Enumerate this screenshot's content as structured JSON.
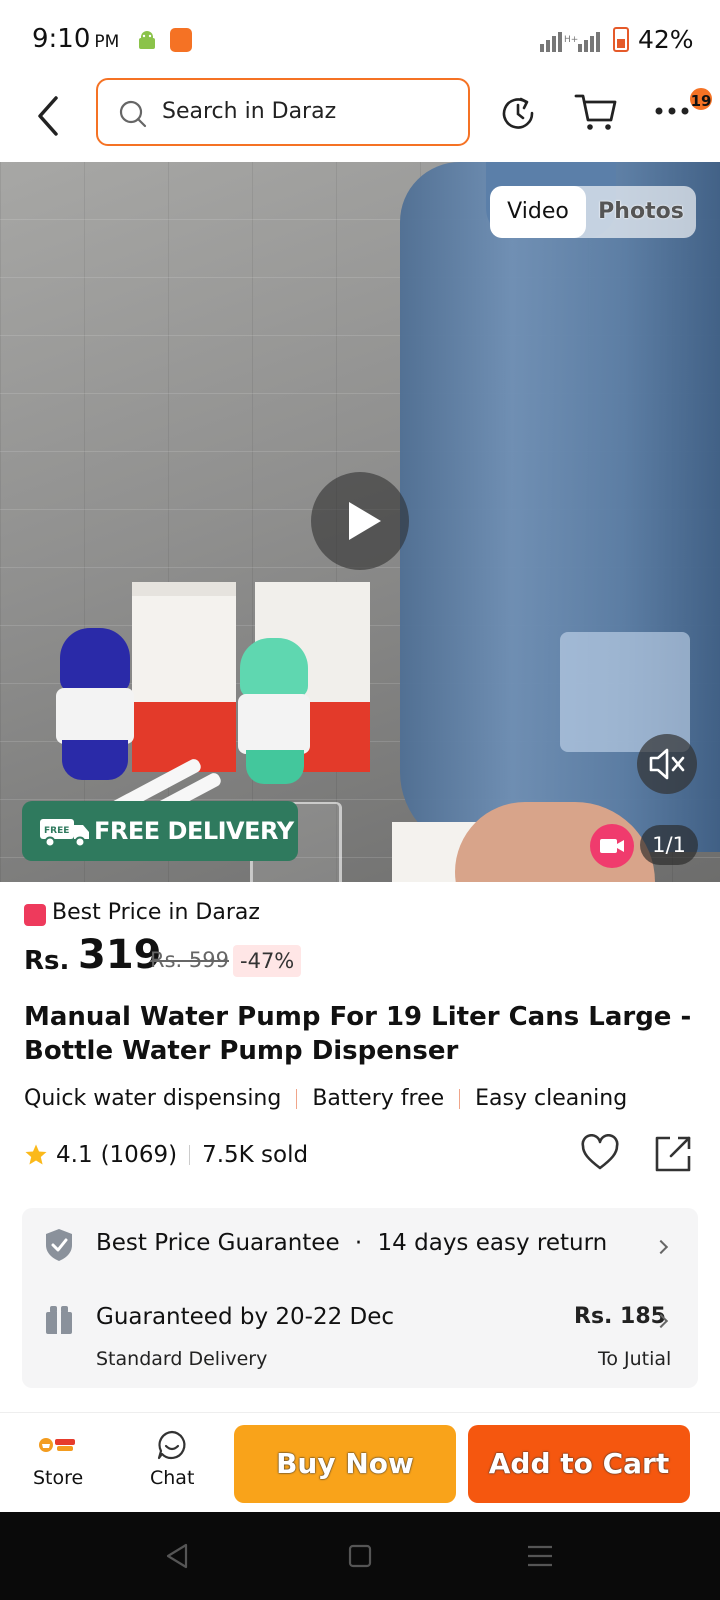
{
  "status_bar": {
    "time": "9:10",
    "ampm": "PM",
    "battery": "42%"
  },
  "header": {
    "search_placeholder": "Search in Daraz",
    "cart_badge": "19"
  },
  "media": {
    "tab_video": "Video",
    "tab_photos": "Photos",
    "free_delivery_tag": "FREE",
    "free_delivery": "FREE DELIVERY",
    "counter": "1/1"
  },
  "product": {
    "best_price_label": "Best Price in Daraz",
    "currency": "Rs.",
    "price": "319",
    "original_price": "Rs. 599",
    "discount": "-47%",
    "title": "Manual Water Pump For 19 Liter Cans Large - Bottle Water Pump Dispenser",
    "tags": [
      "Quick water dispensing",
      "Battery free",
      "Easy cleaning"
    ],
    "rating": "4.1",
    "reviews": "(1069)",
    "sold": "7.5K sold"
  },
  "service_card": {
    "guarantee": "Best Price Guarantee",
    "returns": "14 days easy return",
    "delivery_date": "Guaranteed by 20-22 Dec",
    "delivery_type": "Standard Delivery",
    "delivery_price": "Rs. 185",
    "destination": "To Jutial"
  },
  "bottom_bar": {
    "store": "Store",
    "chat": "Chat",
    "buy_now": "Buy Now",
    "add_to_cart": "Add to Cart"
  },
  "colors": {
    "brand_orange": "#f57224",
    "buy_now": "#f9a31a",
    "add_to_cart": "#f5570f",
    "free_delivery_bg": "#2f7a5e"
  }
}
